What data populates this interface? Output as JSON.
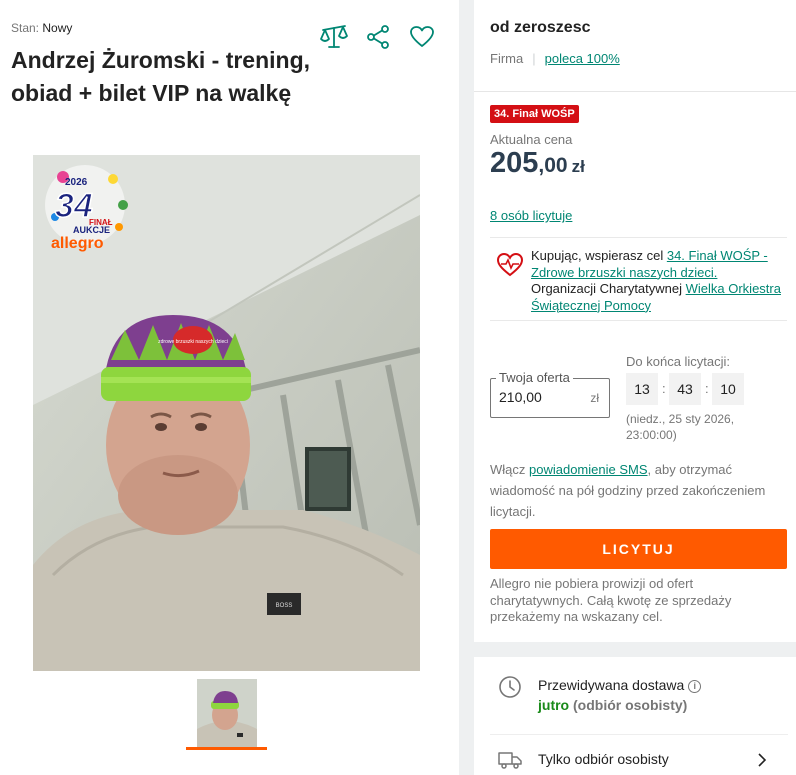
{
  "product": {
    "condition_label": "Stan:",
    "condition_value": "Nowy",
    "title": "Andrzej Żuromski - trening, obiad + bilet VIP na walkę",
    "logo": {
      "year": "2026",
      "number": "34",
      "finale": "FINAŁ",
      "subtitle": "AUKCJE",
      "brand": "allegro"
    },
    "hat_patch_text": "zdrowe brzuszki naszych dzieci",
    "shirt_patch_text": "BOSS"
  },
  "seller": {
    "name": "od zeroszesc",
    "type": "Firma",
    "rating": "poleca 100%"
  },
  "auction": {
    "badge": "34. Finał WOŚP",
    "current_price_label": "Aktualna cena",
    "price_int": "205",
    "price_dec": ",00",
    "currency": "zł",
    "bidders": "8 osób licytuje",
    "charity": {
      "intro": "Kupując, wspierasz cel ",
      "cause_link": "34. Finał WOŚP - Zdrowe brzuszki naszych dzieci.",
      "org_text": " Organizacji Charytatywnej ",
      "org_link": "Wielka Orkiestra Świątecznej Pomocy"
    },
    "offer_label": "Twoja oferta",
    "offer_value": "210,00",
    "offer_currency": "zł",
    "countdown_label": "Do końca licytacji:",
    "countdown": {
      "hours": "13",
      "minutes": "43",
      "seconds": "10"
    },
    "end_date": "(niedz., 25 sty 2026, 23:00:00)",
    "sms": {
      "prefix": "Włącz ",
      "link": "powiadomienie SMS",
      "suffix": ", aby otrzymać wiadomość na pół godziny przed zakończeniem licytacji."
    },
    "bid_button": "LICYTUJ",
    "no_fee_note": "Allegro nie pobiera prowizji od ofert charytatywnych. Całą kwotę ze sprzedaży przekażemy na wskazany cel."
  },
  "delivery": {
    "estimated_label": "Przewidywana dostawa",
    "estimated_when": "jutro",
    "estimated_note": " (odbiór osobisty)",
    "pickup_label": "Tylko odbiór osobisty"
  },
  "colors": {
    "accent": "#ff5a00",
    "link": "#008673",
    "badge": "#d40f14",
    "price": "#2c3e50"
  },
  "icons": [
    "compare-icon",
    "share-icon",
    "heart-icon",
    "charity-heart-icon",
    "info-icon",
    "clock-icon",
    "truck-icon",
    "chevron-right-icon"
  ]
}
